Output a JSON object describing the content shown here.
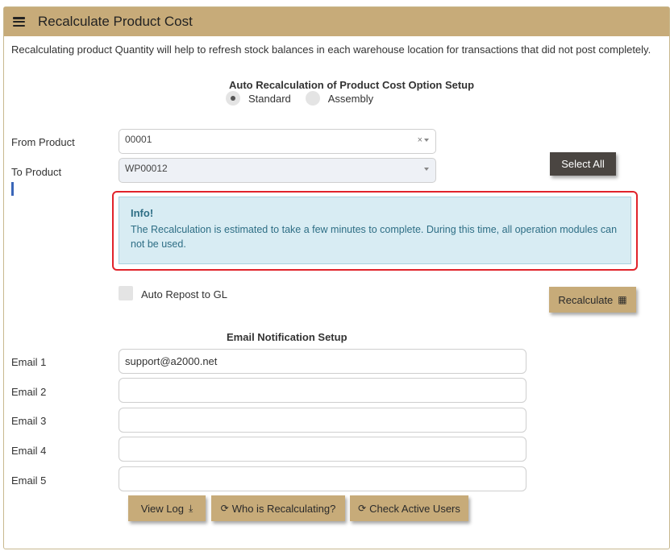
{
  "header": {
    "title": "Recalculate Product Cost",
    "menu_icon": "hamburger-icon"
  },
  "intro_text": "Recalculating product Quantity will help to refresh stock balances in each warehouse location for transactions that did not post completely.",
  "option_setup": {
    "title": "Auto Recalculation of Product Cost Option Setup",
    "options": [
      {
        "label": "Standard",
        "selected": true
      },
      {
        "label": "Assembly",
        "selected": false
      }
    ]
  },
  "from_product": {
    "label": "From Product",
    "value": "00001"
  },
  "to_product": {
    "label": "To Product",
    "value": "WP00012"
  },
  "select_all_label": "Select All",
  "info": {
    "title": "Info!",
    "text": "The Recalculation is estimated to take a few minutes to complete. During this time, all operation modules can not be used."
  },
  "auto_repost": {
    "label": "Auto Repost to GL",
    "checked": false
  },
  "recalculate_label": "Recalculate",
  "email_setup": {
    "title": "Email Notification Setup",
    "emails": [
      {
        "label": "Email 1",
        "value": "support@a2000.net"
      },
      {
        "label": "Email 2",
        "value": ""
      },
      {
        "label": "Email 3",
        "value": ""
      },
      {
        "label": "Email 4",
        "value": ""
      },
      {
        "label": "Email 5",
        "value": ""
      }
    ]
  },
  "actions": {
    "view_log": "View Log",
    "who_is_recalculating": "Who is Recalculating?",
    "check_active_users": "Check Active Users"
  },
  "colors": {
    "accent": "#c7ab79",
    "dark_button": "#4a4541",
    "info_bg": "#d8ecf3",
    "alert_border": "#e1232b"
  }
}
